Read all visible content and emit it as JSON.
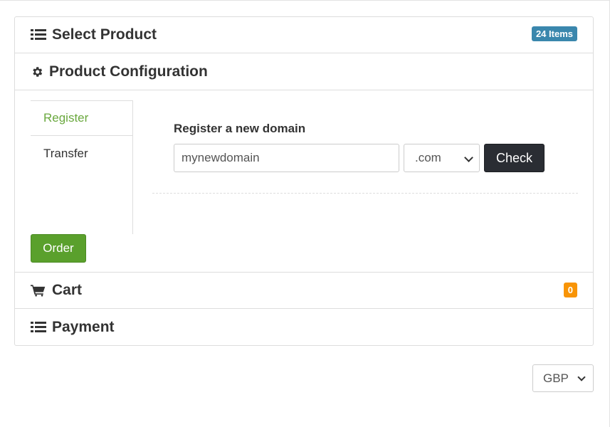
{
  "sections": {
    "select_product": {
      "title": "Select Product",
      "badge": "24 Items",
      "icon": "list-icon"
    },
    "product_configuration": {
      "title": "Product Configuration",
      "icon": "gear-icon"
    },
    "cart": {
      "title": "Cart",
      "badge": "0",
      "icon": "cart-icon"
    },
    "payment": {
      "title": "Payment",
      "icon": "list-icon"
    }
  },
  "tabs": [
    {
      "label": "Register",
      "active": true
    },
    {
      "label": "Transfer",
      "active": false
    }
  ],
  "form": {
    "label": "Register a new domain",
    "domain_value": "mynewdomain",
    "tld_selected": ".com",
    "check_label": "Check"
  },
  "order_label": "Order",
  "currency": {
    "selected": "GBP"
  },
  "colors": {
    "badge_items": "#3a87ad",
    "badge_cart": "#f89406",
    "active_tab": "#6aa83e",
    "order_button": "#5aa02c",
    "check_button": "#2a2d33"
  }
}
